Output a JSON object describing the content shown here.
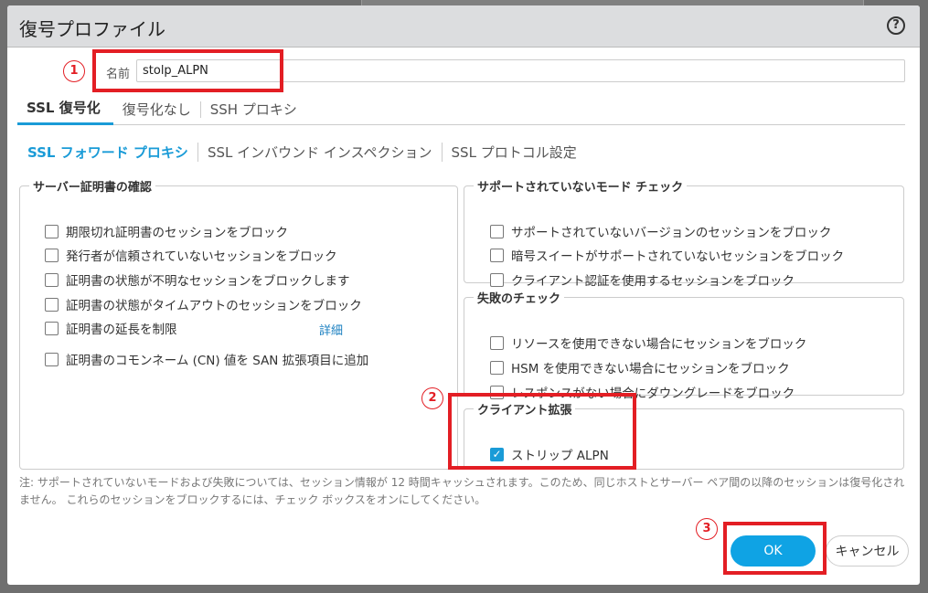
{
  "dialog": {
    "title": "復号プロファイル",
    "help_icon": "?"
  },
  "name": {
    "label": "名前",
    "value": "stolp_ALPN"
  },
  "tabs": [
    {
      "label": "SSL 復号化"
    },
    {
      "label": "復号化なし"
    },
    {
      "label": "SSH プロキシ"
    }
  ],
  "subtabs": [
    {
      "label": "SSL フォワード プロキシ"
    },
    {
      "label": "SSL インバウンド インスペクション"
    },
    {
      "label": "SSL プロトコル設定"
    }
  ],
  "server_cert": {
    "legend": "サーバー証明書の確認",
    "items": [
      {
        "label": "期限切れ証明書のセッションをブロック",
        "checked": false
      },
      {
        "label": "発行者が信頼されていないセッションをブロック",
        "checked": false
      },
      {
        "label": "証明書の状態が不明なセッションをブロックします",
        "checked": false
      },
      {
        "label": "証明書の状態がタイムアウトのセッションをブロック",
        "checked": false
      },
      {
        "label": "証明書の延長を制限",
        "checked": false
      },
      {
        "label": "証明書のコモンネーム (CN) 値を SAN 拡張項目に追加",
        "checked": false
      }
    ],
    "details_link": "詳細"
  },
  "unsupported": {
    "legend": "サポートされていないモード チェック",
    "items": [
      {
        "label": "サポートされていないバージョンのセッションをブロック",
        "checked": false
      },
      {
        "label": "暗号スイートがサポートされていないセッションをブロック",
        "checked": false
      },
      {
        "label": "クライアント認証を使用するセッションをブロック",
        "checked": false
      }
    ]
  },
  "failure": {
    "legend": "失敗のチェック",
    "items": [
      {
        "label": "リソースを使用できない場合にセッションをブロック",
        "checked": false
      },
      {
        "label": "HSM を使用できない場合にセッションをブロック",
        "checked": false
      },
      {
        "label": "レスポンスがない場合にダウングレードをブロック",
        "checked": false
      }
    ]
  },
  "client_ext": {
    "legend": "クライアント拡張",
    "items": [
      {
        "label": "ストリップ ALPN",
        "checked": true
      }
    ]
  },
  "note": "注: サポートされていないモードおよび失敗については、セッション情報が 12 時間キャッシュされます。このため、同じホストとサーバー ペア間の以降のセッションは復号化されません。 これらのセッションをブロックするには、チェック ボックスをオンにしてください。",
  "buttons": {
    "ok": "OK",
    "cancel": "キャンセル"
  },
  "annotations": [
    "1",
    "2",
    "3"
  ],
  "colors": {
    "accent": "#1a9bd7",
    "annotation": "#e31e24"
  }
}
